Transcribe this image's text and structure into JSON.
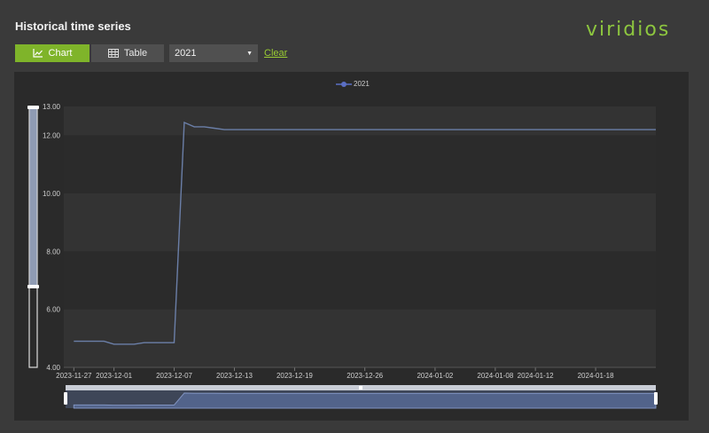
{
  "header": {
    "title": "Historical time series",
    "logo_text": "viridios"
  },
  "toolbar": {
    "chart_label": "Chart",
    "table_label": "Table",
    "year_value": "2021",
    "clear_label": "Clear"
  },
  "colors": {
    "accent": "#7fb42a",
    "series": "#5b6fc4",
    "line": "#6b7fa8",
    "logo": "#8dc63f"
  },
  "chart_data": {
    "type": "line",
    "legend": [
      "2021"
    ],
    "y_ticks": [
      "13.00",
      "12.00",
      "10.00",
      "8.00",
      "6.00",
      "4.00"
    ],
    "y_tick_values": [
      13,
      12,
      10,
      8,
      6,
      4
    ],
    "ylim": [
      4,
      13
    ],
    "x_ticks": [
      "2023-11-27",
      "2023-12-01",
      "2023-12-07",
      "2023-12-13",
      "2023-12-19",
      "2023-12-26",
      "2024-01-02",
      "2024-01-08",
      "2024-01-12",
      "2024-01-18"
    ],
    "series": [
      {
        "name": "2021",
        "x": [
          "2023-11-27",
          "2023-11-28",
          "2023-11-29",
          "2023-11-30",
          "2023-12-01",
          "2023-12-02",
          "2023-12-03",
          "2023-12-04",
          "2023-12-05",
          "2023-12-06",
          "2023-12-07",
          "2023-12-08",
          "2023-12-09",
          "2023-12-10",
          "2023-12-11",
          "2023-12-12",
          "2023-12-14",
          "2023-12-20",
          "2024-01-01",
          "2024-01-12",
          "2024-01-24"
        ],
        "values": [
          4.9,
          4.9,
          4.9,
          4.9,
          4.8,
          4.8,
          4.8,
          4.85,
          4.85,
          4.85,
          4.85,
          12.45,
          12.3,
          12.3,
          12.25,
          12.2,
          12.2,
          12.2,
          12.2,
          12.2,
          12.2
        ]
      }
    ],
    "grid": true
  }
}
